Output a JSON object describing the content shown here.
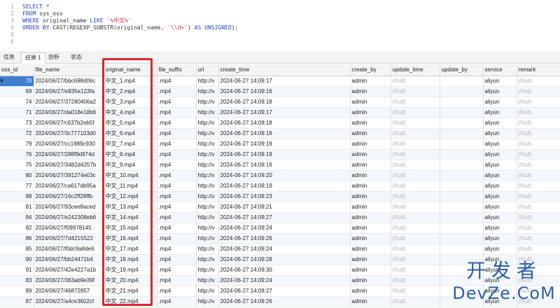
{
  "editor": {
    "lines": [
      {
        "n": "1",
        "parts": [
          {
            "t": "SELECT *",
            "c": "kw"
          }
        ]
      },
      {
        "n": "2",
        "parts": [
          {
            "t": "FROM ",
            "c": "kw"
          },
          {
            "t": "sys_oss",
            "c": "plain"
          }
        ]
      },
      {
        "n": "3",
        "parts": [
          {
            "t": "WHERE ",
            "c": "kw"
          },
          {
            "t": "original_name ",
            "c": "plain"
          },
          {
            "t": "LIKE ",
            "c": "kw"
          },
          {
            "t": "'%中文%'",
            "c": "str"
          }
        ]
      },
      {
        "n": "4",
        "parts": [
          {
            "t": "ORDER BY ",
            "c": "kw"
          },
          {
            "t": "CAST(REGEXP_SUBSTR(original_name, ",
            "c": "plain"
          },
          {
            "t": "'\\\\d+'",
            "c": "str"
          },
          {
            "t": ") ",
            "c": "plain"
          },
          {
            "t": "AS UNSIGNED",
            "c": "kw"
          },
          {
            "t": ");",
            "c": "plain"
          }
        ]
      },
      {
        "n": "5",
        "parts": []
      },
      {
        "n": "6",
        "parts": []
      }
    ]
  },
  "tabs": [
    {
      "label": "信息",
      "active": false
    },
    {
      "label": "结果 1",
      "active": true
    },
    {
      "label": "剖析",
      "active": false
    },
    {
      "label": "状态",
      "active": false
    }
  ],
  "grid": {
    "columns": [
      "oss_id",
      "file_name",
      "original_name",
      "file_suffix",
      "url",
      "create_time",
      "create_by",
      "update_time",
      "update_by",
      "service",
      "remark"
    ],
    "rows": [
      [
        "70",
        "2024/06/27/bbc698d06c",
        "中文_1.mp4",
        ".mp4",
        "http://v",
        "2024-06-27 14:09:17",
        "admin",
        "(Null)",
        "",
        "aliyun",
        "(Null)"
      ],
      [
        "69",
        "2024/06/27/e835e123fa",
        "中文_2.mp4",
        ".mp4",
        "http://v",
        "2024-06-27 14:09:16",
        "admin",
        "(Null)",
        "",
        "aliyun",
        "(Null)"
      ],
      [
        "74",
        "2024/06/27/37280406a2",
        "中文_3.mp4",
        ".mp4",
        "http://v",
        "2024-06-27 14:09:18",
        "admin",
        "(Null)",
        "",
        "aliyun",
        "(Null)"
      ],
      [
        "71",
        "2024/06/27/da018e18b6",
        "中文_4.mp4",
        ".mp4",
        "http://v",
        "2024-06-27 14:09:17",
        "admin",
        "(Null)",
        "",
        "aliyun",
        "(Null)"
      ],
      [
        "73",
        "2024/06/27/c637b2eb5f",
        "中文_5.mp4",
        ".mp4",
        "http://v",
        "2024-06-27 14:09:18",
        "admin",
        "(Null)",
        "",
        "aliyun",
        "(Null)"
      ],
      [
        "72",
        "2024/06/27/3c777103d0",
        "中文_6.mp4",
        ".mp4",
        "http://v",
        "2024-06-27 14:09:18",
        "admin",
        "(Null)",
        "",
        "aliyun",
        "(Null)"
      ],
      [
        "79",
        "2024/06/27/cc1989c930",
        "中文_7.mp4",
        ".mp4",
        "http://v",
        "2024-06-27 14:09:19",
        "admin",
        "(Null)",
        "",
        "aliyun",
        "(Null)"
      ],
      [
        "76",
        "2024/06/27/288f9d974d",
        "中文_8.mp4",
        ".mp4",
        "http://v",
        "2024-06-27 14:09:19",
        "admin",
        "(Null)",
        "",
        "aliyun",
        "(Null)"
      ],
      [
        "75",
        "2024/06/27/3482d4257b",
        "中文_9.mp4",
        ".mp4",
        "http://v",
        "2024-06-27 14:09:19",
        "admin",
        "(Null)",
        "",
        "aliyun",
        "(Null)"
      ],
      [
        "80",
        "2024/06/27/391274e03c",
        "中文_10.mp4",
        ".mp4",
        "http://v",
        "2024-06-27 14:09:20",
        "admin",
        "(Null)",
        "",
        "aliyun",
        "(Null)"
      ],
      [
        "77",
        "2024/06/27/ca617db95a",
        "中文_11.mp4",
        ".mp4",
        "http://v",
        "2024-06-27 14:09:19",
        "admin",
        "(Null)",
        "",
        "aliyun",
        "(Null)"
      ],
      [
        "88",
        "2024/06/27/16c2ff28ffb",
        "中文_12.mp4",
        ".mp4",
        "http://v",
        "2024-06-27 14:09:23",
        "admin",
        "(Null)",
        "",
        "aliyun",
        "(Null)"
      ],
      [
        "81",
        "2024/06/27/93cee8aced",
        "中文_13.mp4",
        ".mp4",
        "http://v",
        "2024-06-27 14:09:21",
        "admin",
        "(Null)",
        "",
        "aliyun",
        "(Null)"
      ],
      [
        "84",
        "2024/06/27/e242308eb6",
        "中文_14.mp4",
        ".mp4",
        "http://v",
        "2024-06-27 14:09:27",
        "admin",
        "(Null)",
        "",
        "aliyun",
        "(Null)"
      ],
      [
        "82",
        "2024/06/27/f09978145",
        "中文_15.mp4",
        ".mp4",
        "http://v",
        "2024-06-27 14:09:24",
        "admin",
        "(Null)",
        "",
        "aliyun",
        "(Null)"
      ],
      [
        "86",
        "2024/06/27/7d4215522",
        "中文_16.mp4",
        ".mp4",
        "http://v",
        "2024-06-27 14:09:26",
        "admin",
        "(Null)",
        "",
        "aliyun",
        "(Null)"
      ],
      [
        "85",
        "2024/06/27/f0dc9a8de6",
        "中文_17.mp4",
        ".mp4",
        "http://v",
        "2024-06-27 14:09:24",
        "admin",
        "(Null)",
        "",
        "aliyun",
        "(Null)"
      ],
      [
        "90",
        "2024/06/27/bb24471b4",
        "中文_18.mp4",
        ".mp4",
        "http://v",
        "2024-06-27 14:09:28",
        "admin",
        "(Null)",
        "",
        "aliyun",
        "(Null)"
      ],
      [
        "91",
        "2024/06/27/42e4227a1b",
        "中文_19.mp4",
        ".mp4",
        "http://v",
        "2024-06-27 14:09:30",
        "admin",
        "(Null)",
        "",
        "aliyun",
        "(Null)"
      ],
      [
        "83",
        "2024/06/27/363ab9e39f",
        "中文_20.mp4",
        ".mp4",
        "http://v",
        "2024-06-27 14:09:24",
        "admin",
        "(Null)",
        "",
        "aliyun",
        "(Null)"
      ],
      [
        "89",
        "2024/06/27/46872857",
        "中文_21.mp4",
        ".mp4",
        "http://v",
        "2024-06-27 14:09:27",
        "admin",
        "(Null)",
        "",
        "aliyun",
        "(Null)"
      ],
      [
        "87",
        "2024/06/27/a4ce3602cf",
        "中文_22.mp4",
        ".mp4",
        "http://v",
        "2024-06-27 14:09:26",
        "admin",
        "(Null)",
        "",
        "aliyun",
        "(Null)"
      ]
    ]
  },
  "watermark": {
    "top": "开发者",
    "bottom": "DevZe.CoM"
  },
  "colors": {
    "highlight": "#e0242c",
    "selected": "#3d7fd1",
    "keyword": "#2347c8",
    "string": "#c43b3b"
  }
}
